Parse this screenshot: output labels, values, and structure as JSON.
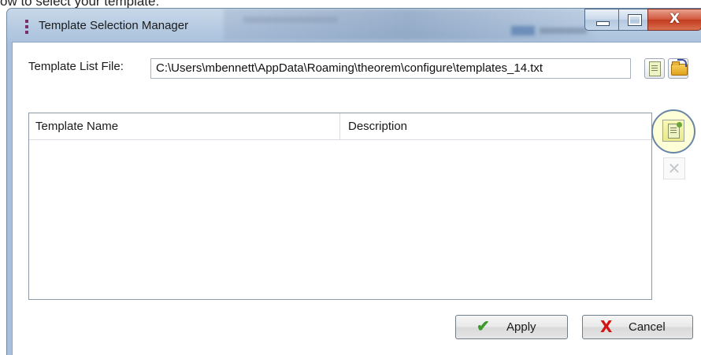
{
  "background_strip": {
    "text": "ow to select your template:"
  },
  "window": {
    "title": "Template Selection Manager",
    "controls": {
      "close_glyph": "X"
    }
  },
  "file_row": {
    "label": "Template List File:",
    "path": "C:\\Users\\mbennett\\AppData\\Roaming\\theorem\\configure\\templates_14.txt",
    "new_icon": "new-document-icon",
    "open_icon": "open-folder-icon"
  },
  "template_table": {
    "columns": [
      "Template Name",
      "Description"
    ],
    "rows": []
  },
  "side_buttons": {
    "add_icon": "add-template-icon",
    "delete_glyph": "✕"
  },
  "footer": {
    "apply_label": "Apply",
    "apply_glyph": "✔",
    "cancel_label": "Cancel",
    "cancel_glyph": "X"
  },
  "colors": {
    "highlight": "#ffff8c",
    "apply_check": "#3c9a2a",
    "cancel_x": "#d31414",
    "close_button": "#c33a1f"
  }
}
